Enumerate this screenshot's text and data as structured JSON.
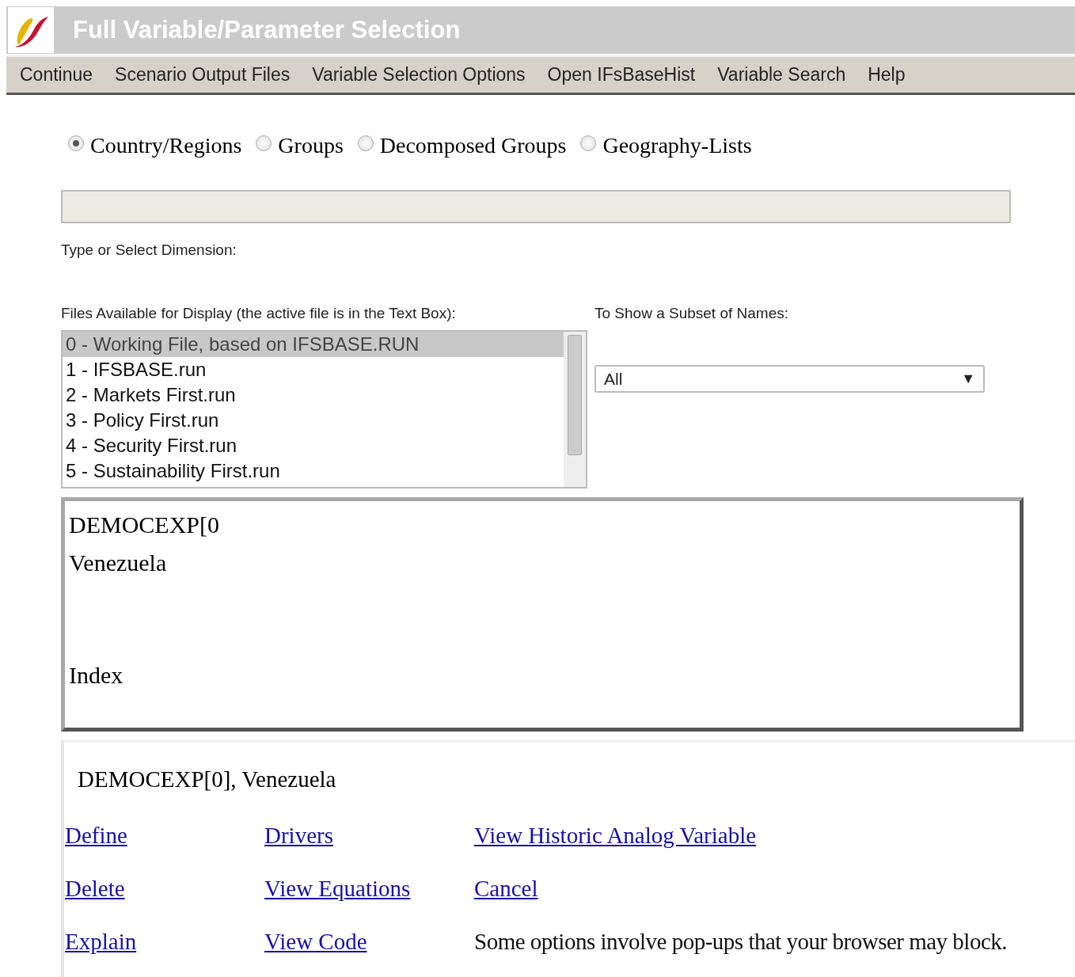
{
  "window": {
    "title": "Full Variable/Parameter Selection"
  },
  "menu": [
    "Continue",
    "Scenario Output Files",
    "Variable Selection Options",
    "Open IFsBaseHist",
    "Variable Search",
    "Help"
  ],
  "dimension_options": [
    {
      "label": "Country/Regions",
      "selected": true
    },
    {
      "label": "Groups",
      "selected": false
    },
    {
      "label": "Decomposed Groups",
      "selected": false
    },
    {
      "label": "Geography-Lists",
      "selected": false
    }
  ],
  "dimension_label": "Type or Select Dimension:",
  "files": {
    "label": "Files Available for Display (the active file is in the Text Box):",
    "items": [
      {
        "label": "0 - Working File, based on IFSBASE.RUN",
        "selected": true
      },
      {
        "label": "1 - IFSBASE.run",
        "selected": false
      },
      {
        "label": "2 - Markets First.run",
        "selected": false
      },
      {
        "label": "3 - Policy First.run",
        "selected": false
      },
      {
        "label": "4 - Security First.run",
        "selected": false
      },
      {
        "label": "5 - Sustainability First.run",
        "selected": false
      }
    ]
  },
  "subset": {
    "label": "To Show a Subset of Names:",
    "value": "All",
    "arrow": "▼"
  },
  "selection_box": {
    "lines": [
      "DEMOCEXP[0",
      "Venezuela",
      "Index"
    ]
  },
  "summary": "DEMOCEXP[0], Venezuela",
  "actions": [
    {
      "kind": "link",
      "text": "Define"
    },
    {
      "kind": "link",
      "text": "Drivers"
    },
    {
      "kind": "link",
      "text": "View Historic Analog Variable"
    },
    {
      "kind": "link",
      "text": "Delete"
    },
    {
      "kind": "link",
      "text": "View Equations"
    },
    {
      "kind": "link",
      "text": "Cancel"
    },
    {
      "kind": "link",
      "text": "Explain"
    },
    {
      "kind": "link",
      "text": "View Code"
    },
    {
      "kind": "note",
      "text": "Some options involve pop-ups that your browser may block."
    }
  ]
}
